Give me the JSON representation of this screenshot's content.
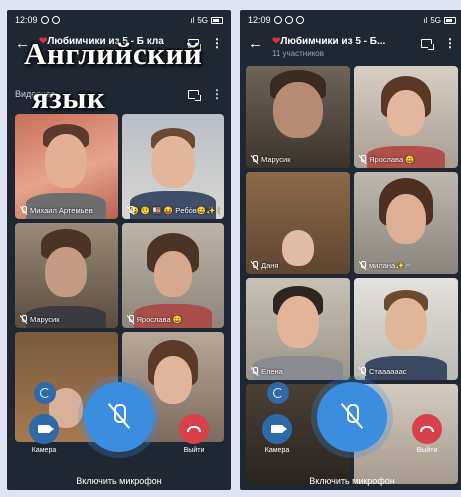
{
  "overlay": {
    "line1": "Английский",
    "line2": "язык"
  },
  "left": {
    "status": {
      "time": "12:09",
      "network": "5G",
      "signal": "ıl"
    },
    "title": "Любимчики из 5 - Б кла",
    "section_label": "Видеочат",
    "tiles": [
      {
        "name": "Михаил Артемьев"
      },
      {
        "name": "😀 🤨 🍱 😝 Peбόв😀✨ 💫"
      },
      {
        "name": "Марусик"
      },
      {
        "name": "Ярослава 😀"
      },
      {
        "name": ""
      },
      {
        "name": ""
      }
    ],
    "controls": {
      "camera": "Камера",
      "leave": "Выйти",
      "mic_caption": "Включить микрофон"
    }
  },
  "right": {
    "status": {
      "time": "12:09",
      "network": "5G",
      "signal": "ıl"
    },
    "title": "Любимчики из 5 - Б...",
    "subtitle": "11 участников",
    "tiles": [
      {
        "name": "Марусик"
      },
      {
        "name": "Ярослава 😀"
      },
      {
        "name": "Даня"
      },
      {
        "name": "милана✨♾"
      },
      {
        "name": "Елена"
      },
      {
        "name": "Стаааааас"
      },
      {
        "name": ""
      },
      {
        "name": ""
      }
    ],
    "controls": {
      "camera": "Камера",
      "leave": "Выйти",
      "mic_caption": "Включить микрофон"
    }
  },
  "icons": [
    "back-arrow-icon",
    "cast-icon",
    "more-vert-icon",
    "mic-off-icon",
    "flip-camera-icon",
    "camera-icon",
    "phone-hangup-icon",
    "heart-icon"
  ],
  "colors": {
    "app_bg": "#1f2733",
    "accent_blue": "#3b8de0",
    "leave_red": "#d9414a",
    "speaking_green": "#56b65a"
  }
}
